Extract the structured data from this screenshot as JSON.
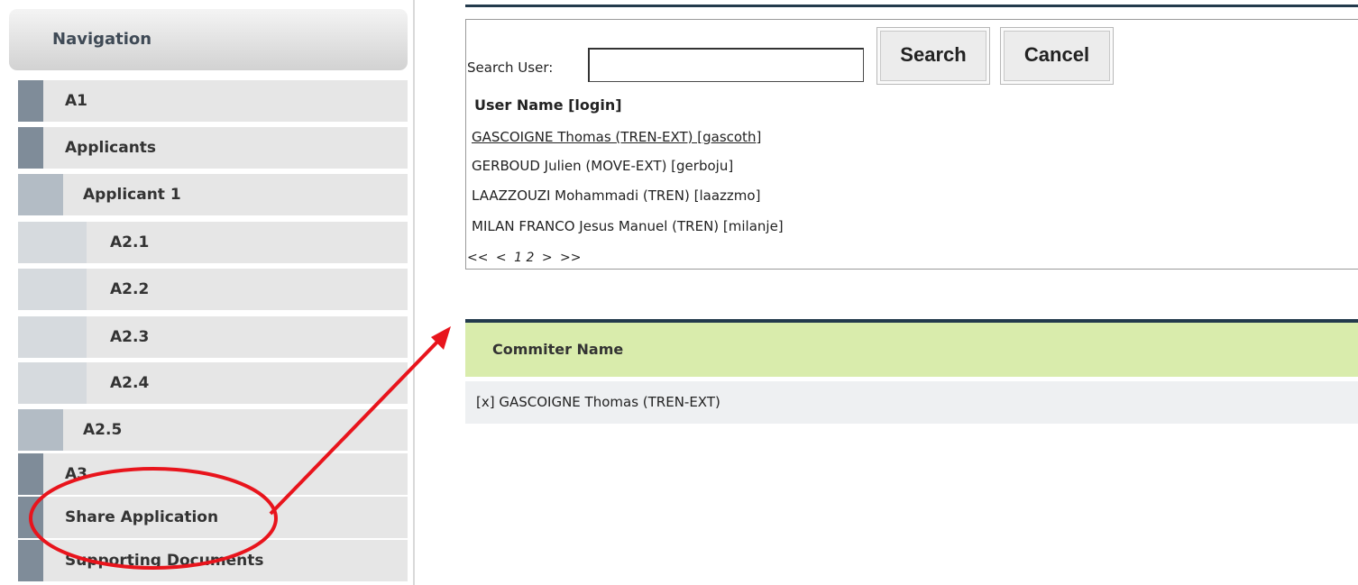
{
  "sidebar": {
    "header": "Navigation",
    "items": [
      {
        "label": "A1"
      },
      {
        "label": "Applicants"
      },
      {
        "label": "Applicant 1"
      },
      {
        "label": "A2.1"
      },
      {
        "label": "A2.2"
      },
      {
        "label": "A2.3"
      },
      {
        "label": "A2.4"
      },
      {
        "label": "A2.5"
      },
      {
        "label": "A3"
      },
      {
        "label": "Share Application"
      },
      {
        "label": "Supporting Documents"
      }
    ]
  },
  "search": {
    "label": "Search User:",
    "value": "",
    "search_button": "Search",
    "cancel_button": "Cancel",
    "results_header": "User Name [login]",
    "results": [
      "GASCOIGNE Thomas (TREN-EXT) [gascoth]",
      "GERBOUD Julien (MOVE-EXT) [gerboju]",
      "LAAZZOUZI Mohammadi (TREN) [laazzmo]",
      "MILAN FRANCO Jesus Manuel (TREN) [milanje]"
    ],
    "pager": {
      "first": "<<",
      "prev": "<",
      "page1": "1",
      "page2": "2",
      "next": ">",
      "last": ">>"
    }
  },
  "commiters": {
    "header": "Commiter Name",
    "rows": [
      "[x] GASCOIGNE Thomas (TREN-EXT)"
    ]
  },
  "colors": {
    "annotation": "#e8141c",
    "table_header": "#d9ecac",
    "rule": "#233a4c"
  }
}
